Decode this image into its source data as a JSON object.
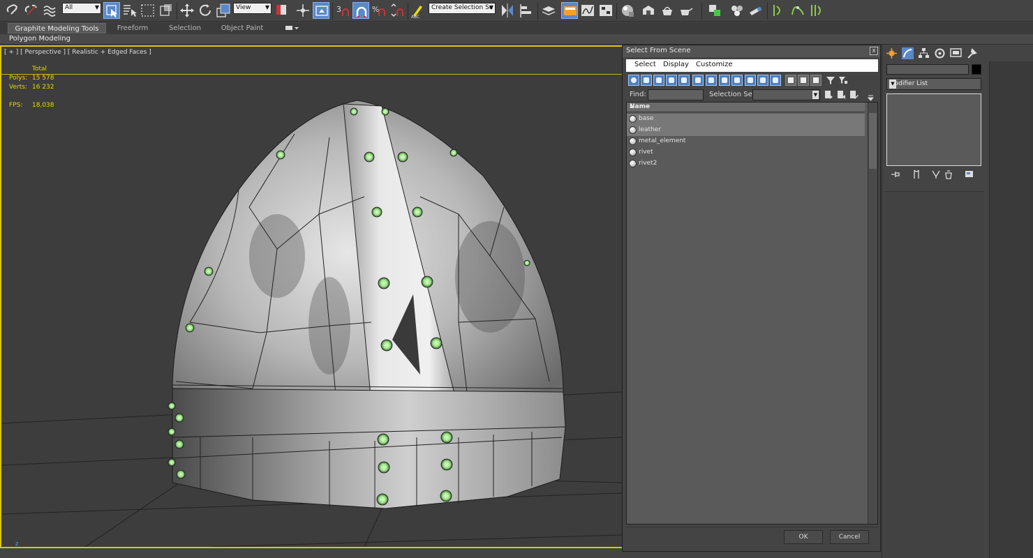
{
  "toolbar": {
    "filter_select": "All",
    "coord_select": "View",
    "selection_set": "Create Selection Se"
  },
  "ribbon": {
    "tabs": [
      {
        "label": "Graphite Modeling Tools",
        "active": true
      },
      {
        "label": "Freeform",
        "active": false
      },
      {
        "label": "Selection",
        "active": false
      },
      {
        "label": "Object Paint",
        "active": false
      }
    ],
    "panel_label": "Polygon Modeling"
  },
  "viewport": {
    "label": "[ + ] [ Perspective ] [ Realistic + Edged Faces ]",
    "stats": {
      "total_label": "Total",
      "polys_label": "Polys:",
      "polys_value": "15 578",
      "verts_label": "Verts:",
      "verts_value": "16 232",
      "fps_label": "FPS:",
      "fps_value": "18,038"
    },
    "axis_label": "z"
  },
  "dialog": {
    "title": "Select From Scene",
    "close": "x",
    "menu": [
      "Select",
      "Display",
      "Customize"
    ],
    "find_label": "Find:",
    "find_value": "",
    "selection_set_label": "Selection Set:",
    "list_header": "Name",
    "items": [
      {
        "name": "base",
        "selected": true
      },
      {
        "name": "leather",
        "selected": true
      },
      {
        "name": "metal_element",
        "selected": false
      },
      {
        "name": "rivet",
        "selected": false
      },
      {
        "name": "rivet2",
        "selected": false
      }
    ],
    "ok_label": "OK",
    "cancel_label": "Cancel"
  },
  "command_panel": {
    "modifier_list_label": "Modifier List",
    "object_color": "#000000"
  },
  "colors": {
    "viewport_border": "#d9c700",
    "stat_text": "#e8d900",
    "active_blue": "#5a88c8"
  }
}
